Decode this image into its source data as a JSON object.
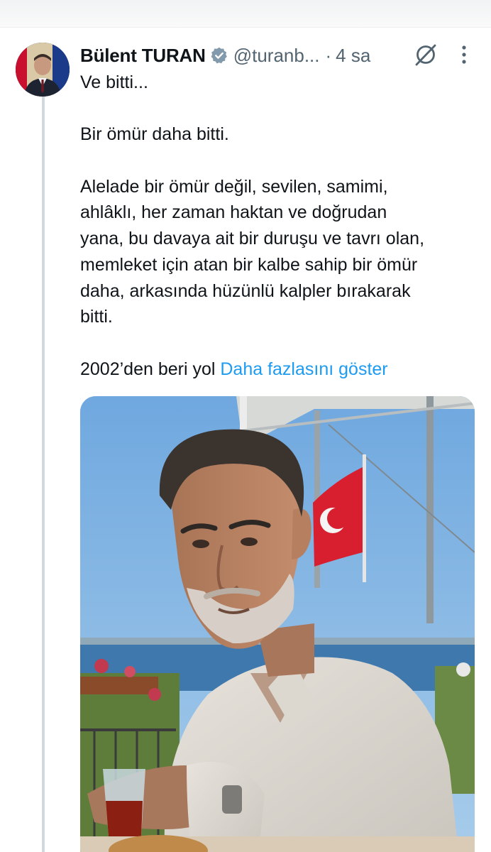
{
  "tweet": {
    "author_name": "Bülent TURAN",
    "handle": "@turanb...",
    "separator": "·",
    "time": "4 sa",
    "lines": {
      "l1": "Ve bitti...",
      "l2": "Bir ömür daha bitti.",
      "l3": "Alelade bir ömür değil, sevilen, samimi,",
      "l4": "ahlâklı,  her zaman haktan ve doğrudan",
      "l5": "yana, bu davaya ait bir duruşu ve tavrı olan,",
      "l6": "memleket için atan bir kalbe sahip bir ömür",
      "l7": "daha, arkasında hüzünlü kalpler bırakarak",
      "l8": "bitti.",
      "l9": "2002’den beri yol "
    },
    "show_more": "Daha fazlasını göster"
  },
  "icons": {
    "verified": "verified-badge-icon",
    "grok": "grok-icon",
    "more": "more-vertical-icon"
  },
  "colors": {
    "text": "#0f1419",
    "secondary": "#536471",
    "link": "#1d9bf0",
    "thread_line": "#cfd9de"
  }
}
